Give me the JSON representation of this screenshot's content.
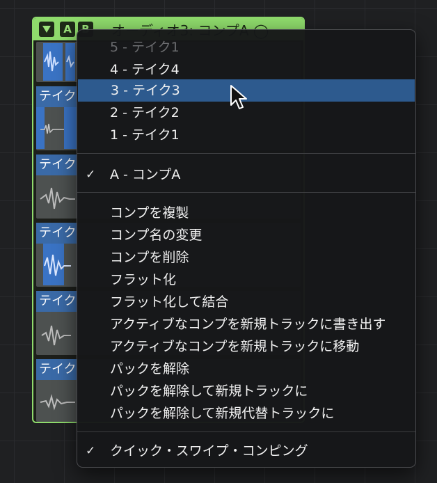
{
  "region": {
    "header": {
      "collapse_icon": "triangle-down-icon",
      "btn_a": "A",
      "btn_b": "B",
      "title": "オーディオ3: コンプA ◯"
    },
    "takes": [
      {
        "label": ""
      },
      {
        "label": "テイク"
      },
      {
        "label": "テイク"
      },
      {
        "label": "テイク"
      },
      {
        "label": "テイク"
      },
      {
        "label": "テイク"
      }
    ]
  },
  "menu": {
    "takes": [
      {
        "label": "5 - テイク1",
        "disabled": true
      },
      {
        "label": "4 - テイク4"
      },
      {
        "label": "3 - テイク3",
        "highlighted": true
      },
      {
        "label": "2 - テイク2"
      },
      {
        "label": "1 - テイク1"
      }
    ],
    "comps": [
      {
        "label": "A - コンプA",
        "checked": true,
        "check": "✓"
      }
    ],
    "actions": [
      "コンプを複製",
      "コンプ名の変更",
      "コンプを削除",
      "フラット化",
      "フラット化して結合",
      "アクティブなコンプを新規トラックに書き出す",
      "アクティブなコンプを新規トラックに移動",
      "パックを解除",
      "パックを解除して新規トラックに",
      "パックを解除して新規代替トラックに"
    ],
    "quick_swipe": {
      "label": "クイック・スワイプ・コンピング",
      "checked": true,
      "check": "✓"
    }
  },
  "colors": {
    "region_green": "#8fdb6c",
    "highlight": "#2d5a8e",
    "take_blue": "#3a6aa7"
  }
}
